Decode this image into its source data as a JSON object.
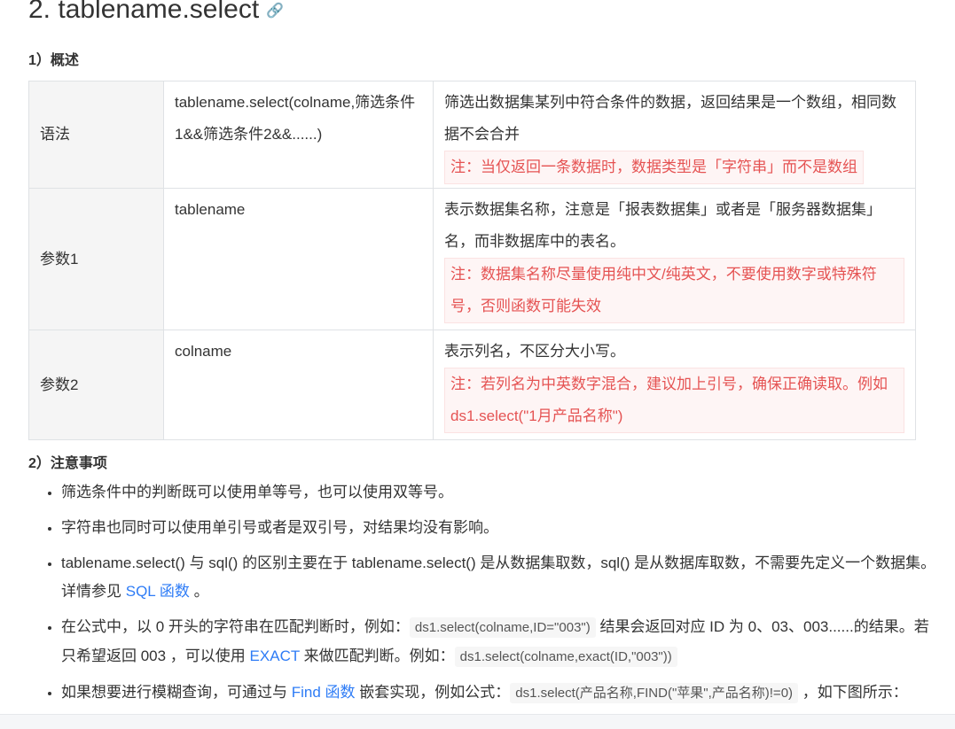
{
  "section": {
    "title": "2. tablename.select",
    "link_icon": "link-icon"
  },
  "overview": {
    "heading": "1）概述",
    "rows": [
      {
        "key": "语法",
        "value": "tablename.select(colname,筛选条件1&&筛选条件2&&......)",
        "desc": "筛选出数据集某列中符合条件的数据，返回结果是一个数组，相同数据不会合并",
        "note": "注：当仅返回一条数据时，数据类型是「字符串」而不是数组"
      },
      {
        "key": "参数1",
        "value": "tablename",
        "desc": "表示数据集名称，注意是「报表数据集」或者是「服务器数据集」名，而非数据库中的表名。",
        "note": "注：数据集名称尽量使用纯中文/纯英文，不要使用数字或特殊符号，否则函数可能失效"
      },
      {
        "key": "参数2",
        "value": "colname",
        "desc": "表示列名，不区分大小写。",
        "note": "注：若列名为中英数字混合，建议加上引号，确保正确读取。例如ds1.select(\"1月产品名称\")"
      }
    ]
  },
  "notes": {
    "heading": "2）注意事项",
    "items": [
      {
        "text": "筛选条件中的判断既可以使用单等号，也可以使用双等号。"
      },
      {
        "text": "字符串也同时可以使用单引号或者是双引号，对结果均没有影响。"
      },
      {
        "part1": "tablename.select() 与 sql() 的区别主要在于 tablename.select() 是从数据集取数，sql() 是从数据库取数，不需要先定义一个数据集。详情参见 ",
        "link": "SQL 函数",
        "part2": " 。"
      },
      {
        "part1": "在公式中，以 0 开头的字符串在匹配判断时，例如：",
        "code1": "ds1.select(colname,ID=\"003\")",
        "part2": " 结果会返回对应 ID 为 0、03、003......的结果。若只希望返回 003 ，可以使用 ",
        "link": "EXACT",
        "part3": " 来做匹配判断。例如：",
        "code2": "ds1.select(colname,exact(ID,\"003\"))"
      },
      {
        "part1": "如果想要进行模糊查询，可通过与 ",
        "link": "Find 函数",
        "part2": " 嵌套实现，例如公式：",
        "code1": "ds1.select(产品名称,FIND(\"苹果\",产品名称)!=0)",
        "part3": " ，如下图所示："
      }
    ]
  }
}
